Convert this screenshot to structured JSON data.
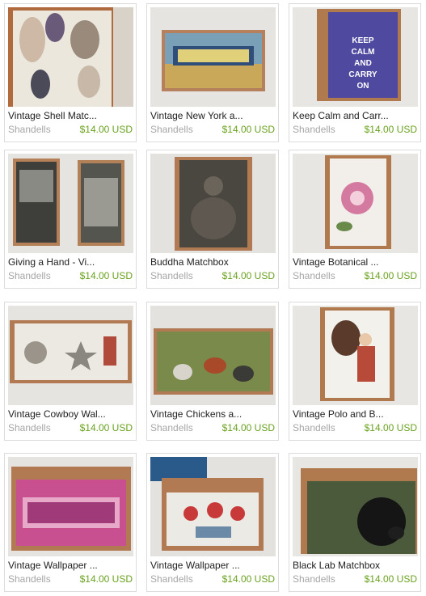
{
  "listings": [
    {
      "title": "Vintage Shell Matc...",
      "shop": "Shandells",
      "price": "$14.00 USD",
      "image_icon": "shell-matchbox-image"
    },
    {
      "title": "Vintage New York a...",
      "shop": "Shandells",
      "price": "$14.00 USD",
      "image_icon": "new-york-matchbox-image"
    },
    {
      "title": "Keep Calm and Carr...",
      "shop": "Shandells",
      "price": "$14.00 USD",
      "image_icon": "keep-calm-matchbox-image",
      "image_text": [
        "KEEP",
        "CALM",
        "AND",
        "CARRY",
        "ON"
      ]
    },
    {
      "title": "Giving a Hand - Vi...",
      "shop": "Shandells",
      "price": "$14.00 USD",
      "image_icon": "giving-hand-matchbox-image"
    },
    {
      "title": "Buddha Matchbox",
      "shop": "Shandells",
      "price": "$14.00 USD",
      "image_icon": "buddha-matchbox-image"
    },
    {
      "title": "Vintage Botanical ...",
      "shop": "Shandells",
      "price": "$14.00 USD",
      "image_icon": "botanical-matchbox-image"
    },
    {
      "title": "Vintage Cowboy Wal...",
      "shop": "Shandells",
      "price": "$14.00 USD",
      "image_icon": "cowboy-matchbox-image"
    },
    {
      "title": "Vintage Chickens a...",
      "shop": "Shandells",
      "price": "$14.00 USD",
      "image_icon": "chickens-matchbox-image"
    },
    {
      "title": "Vintage Polo and B...",
      "shop": "Shandells",
      "price": "$14.00 USD",
      "image_icon": "polo-matchbox-image"
    },
    {
      "title": "Vintage Wallpaper ...",
      "shop": "Shandells",
      "price": "$14.00 USD",
      "image_icon": "greek-key-matchbox-image"
    },
    {
      "title": "Vintage Wallpaper ...",
      "shop": "Shandells",
      "price": "$14.00 USD",
      "image_icon": "tulip-wallpaper-matchbox-image"
    },
    {
      "title": "Black Lab Matchbox",
      "shop": "Shandells",
      "price": "$14.00 USD",
      "image_icon": "black-lab-matchbox-image"
    }
  ],
  "colors": {
    "price": "#6aa21f",
    "shop": "#a6a6a6",
    "title": "#222222",
    "border": "#dcdcdc"
  }
}
